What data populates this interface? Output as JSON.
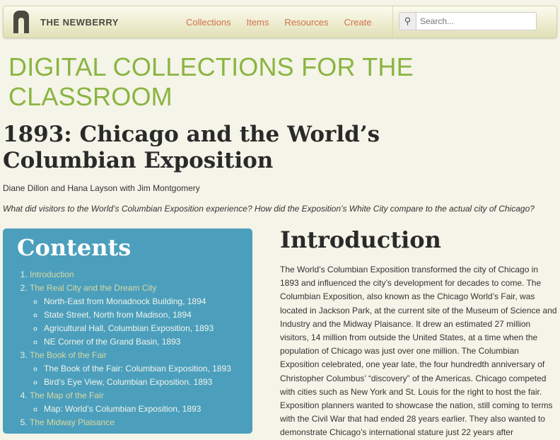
{
  "nav": {
    "logo": "THE NEWBERRY",
    "menu": [
      "Collections",
      "Items",
      "Resources",
      "Create"
    ],
    "search_placeholder": "Search..."
  },
  "site_title": "DIGITAL COLLECTIONS FOR THE CLASSROOM",
  "page": {
    "title": "1893: Chicago and the World’s Columbian Exposition",
    "authors": "Diane Dillon and Hana Layson with Jim Montgomery",
    "question": "What did visitors to the World’s Columbian Exposition experience? How did the Exposition’s White City compare to the actual city of Chicago?"
  },
  "toc": {
    "heading": "Contents",
    "items": [
      {
        "label": "Introduction",
        "sub": []
      },
      {
        "label": "The Real City and the Dream City",
        "sub": [
          "North-East from Monadnock Building, 1894",
          "State Street, North from Madison, 1894",
          "Agricultural Hall, Columbian Exposition, 1893",
          "NE Corner of the Grand Basin, 1893"
        ]
      },
      {
        "label": "The Book of the Fair",
        "sub": [
          "The Book of the Fair: Columbian Exposition, 1893",
          "Bird’s Eye View, Columbian Exposition. 1893"
        ]
      },
      {
        "label": "The Map of the Fair",
        "sub": [
          "Map: World’s Columbian Exposition, 1893"
        ]
      },
      {
        "label": "The Midway Plaisance",
        "sub": []
      }
    ]
  },
  "intro": {
    "heading": "Introduction",
    "text": "The World’s Columbian Exposition transformed the city of Chicago in 1893 and influenced the city’s development for decades to come. The Columbian Exposition, also known as the Chicago World’s Fair, was located in Jackson Park, at the current site of the Museum of Science and Industry and the Midway Plaisance. It drew an estimated 27 million visitors, 14 million from outside the United States, at a time when the population of Chicago was just over one million. The Columbian Exposition celebrated, one year late, the four hundredth anniversary of Christopher Columbus’ “discovery” of the Americas. Chicago competed with cities such as New York and St. Louis for the right to host the fair. Exposition planners wanted to showcase the nation, still coming to terms with the Civil War that had ended 28 years earlier. They also wanted to demonstrate Chicago’s international stature just 22 years after"
  }
}
